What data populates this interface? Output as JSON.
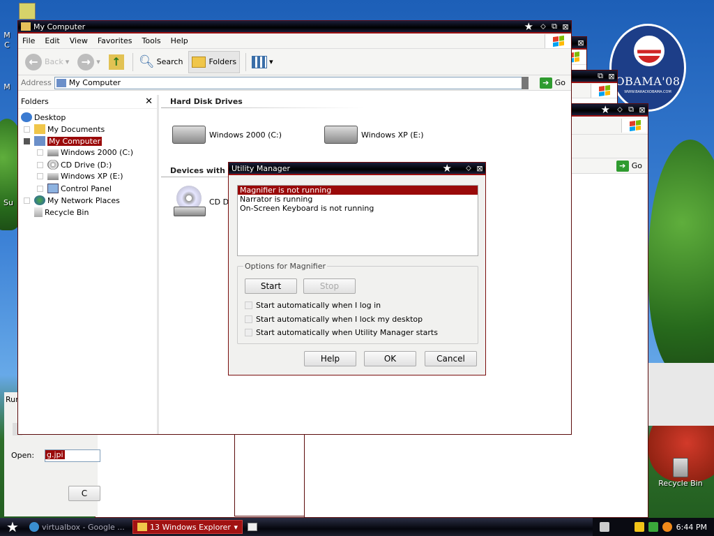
{
  "explorer": {
    "title": "My Computer",
    "menu": [
      "File",
      "Edit",
      "View",
      "Favorites",
      "Tools",
      "Help"
    ],
    "toolbar": {
      "back": "Back",
      "search": "Search",
      "folders": "Folders"
    },
    "address_label": "Address",
    "address_value": "My Computer",
    "go": "Go",
    "folders_pane_title": "Folders",
    "tree": [
      {
        "label": "Desktop"
      },
      {
        "label": "My Documents"
      },
      {
        "label": "My Computer"
      },
      {
        "label": "Windows 2000 (C:)"
      },
      {
        "label": "CD Drive (D:)"
      },
      {
        "label": "Windows XP (E:)"
      },
      {
        "label": "Control Panel"
      },
      {
        "label": "My Network Places"
      },
      {
        "label": "Recycle Bin"
      }
    ],
    "groups": {
      "hard_disk": "Hard Disk Drives",
      "removable": "Devices with R"
    },
    "drives": [
      "Windows 2000 (C:)",
      "Windows XP (E:)",
      "CD Dri"
    ]
  },
  "background_window": {
    "go": "Go"
  },
  "utility_manager": {
    "title": "Utility Manager",
    "list": [
      "Magnifier is not running",
      "Narrator is running",
      "On-Screen Keyboard is not running"
    ],
    "group_label": "Options for Magnifier",
    "start": "Start",
    "stop": "Stop",
    "options": [
      "Start automatically when I log in",
      "Start automatically when I lock my desktop",
      "Start automatically when Utility Manager starts"
    ],
    "help": "Help",
    "ok": "OK",
    "cancel": "Cancel"
  },
  "run_dialog": {
    "title": "Run",
    "open_label": "Open:",
    "open_value": "g.jpi",
    "button": "C"
  },
  "desktop": {
    "recycle_bin": "Recycle Bin",
    "logo_text": "OBAMA'08",
    "logo_sub": "WWW.BARACKOBAMA.COM",
    "left_edge_labels": [
      "M",
      "C",
      "M",
      "Su"
    ]
  },
  "taskbar": {
    "tasks": [
      "virtualbox - Google ...",
      "13 Windows Explorer"
    ],
    "clock": "6:44 PM"
  },
  "colors": {
    "accent": "#9a0a0a",
    "titlebar": "#000000",
    "taskbar": "#05060d"
  }
}
